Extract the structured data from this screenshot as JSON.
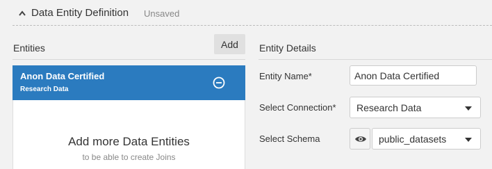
{
  "header": {
    "title": "Data Entity Definition",
    "status": "Unsaved",
    "collapse_icon": "chevron-up-icon"
  },
  "entities": {
    "label": "Entities",
    "add_label": "Add",
    "items": [
      {
        "name": "Anon Data Certified",
        "connection": "Research Data",
        "selected": true,
        "remove_icon": "minus-circle-icon"
      }
    ],
    "empty_title": "Add more Data Entities",
    "empty_subtitle": "to be able to create Joins"
  },
  "details": {
    "label": "Entity Details",
    "entity_name_label": "Entity Name*",
    "entity_name_value": "Anon Data Certified",
    "connection_label": "Select Connection*",
    "connection_value": "Research Data",
    "schema_label": "Select Schema",
    "schema_value": "public_datasets",
    "schema_preview_icon": "eye-icon"
  },
  "colors": {
    "accent": "#2b7bbf",
    "background": "#f2f2f2"
  }
}
